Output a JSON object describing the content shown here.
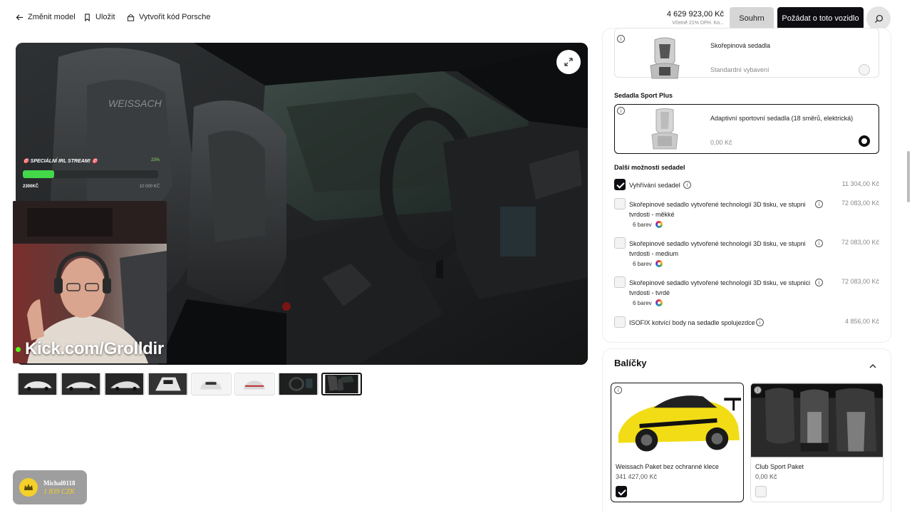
{
  "header": {
    "back_label": "Změnit model",
    "save_label": "Uložit",
    "code_label": "Vytvořit kód Porsche",
    "price": "4 629 923,00 Kč",
    "price_note": "Včetně 21% DPH. Ko...",
    "summary_label": "Souhrn",
    "request_label": "Požádat o toto vozidlo"
  },
  "stream": {
    "title": "🎯 SPECIÁLNÍ IRL STREAM! 🎯",
    "percent": "23%",
    "progress": 0.23,
    "current": "2300KČ",
    "goal": "10 000 KČ",
    "kick": "Kick.com/Grolldir"
  },
  "gallery": {
    "thumb_count": 8,
    "active_index": 7
  },
  "donation": {
    "name": "Michal0118",
    "amount": "1 839 CZK"
  },
  "seats": {
    "shell": {
      "name": "Skořepinová sedadla",
      "price": "Standardní vybavení"
    },
    "sport_plus_heading": "Sedadla Sport Plus",
    "sport_plus": {
      "name": "Adaptivní sportovní sedadla (18 směrů, elektrická)",
      "price": "0,00 Kč"
    },
    "more_heading": "Další možnosti sedadel",
    "options": [
      {
        "label": "Vyhřívání sedadel",
        "price": "11 304,00 Kč",
        "checked": true
      },
      {
        "label": "Skořepinové sedadlo vytvořené technologií 3D tisku, ve stupni tvrdosti - měkké",
        "price": "72 083,00 Kč",
        "colors": "6 barev",
        "checked": false
      },
      {
        "label": "Skořepinové sedadlo vytvořené technologií 3D tisku, ve stupni tvrdosti - medium",
        "price": "72 083,00 Kč",
        "colors": "6 barev",
        "checked": false
      },
      {
        "label": "Skořepinové sedadlo vytvořené technologií 3D tisku, ve stupnici tvrdosti - tvrdé",
        "price": "72 083,00 Kč",
        "colors": "6 barev",
        "checked": false
      },
      {
        "label": "ISOFIX kotvící body na sedadle spolujezdce",
        "price": "4 856,00 Kč",
        "checked": false
      }
    ]
  },
  "packages": {
    "title": "Balíčky",
    "items": [
      {
        "name": "Weissach Paket bez ochranné klece",
        "price": "341 427,00 Kč",
        "checked": true
      },
      {
        "name": "Club Sport Paket",
        "price": "0,00 Kč",
        "checked": false
      }
    ]
  },
  "colors": {
    "accent": "#0e0e12",
    "kick_green": "#53fc18",
    "progress_green": "#42d84a",
    "car_yellow": "#f2dc16"
  },
  "icons": [
    "arrow-left-icon",
    "bookmark-icon",
    "car-code-icon",
    "search-icon",
    "expand-icon",
    "info-icon",
    "chevron-up-icon",
    "crown-icon",
    "color-wheel-icon"
  ]
}
